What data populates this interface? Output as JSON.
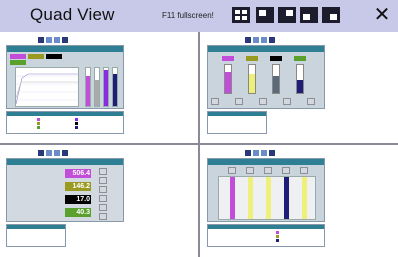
{
  "header": {
    "title": "Quad View",
    "hint": "F11 fullscreen!"
  },
  "colors": {
    "header_bg": "#c8c9e8",
    "panel_header": "#2e7f93",
    "purple": "#c24dd9",
    "blue_violet": "#8a2be2",
    "yellow": "#eef07a",
    "olive": "#9a9a20",
    "black": "#000000",
    "green": "#5aa02c",
    "navy": "#1e1e78"
  },
  "quad3": {
    "values": [
      "506.4",
      "146.2",
      "17.0",
      "40.3"
    ]
  }
}
